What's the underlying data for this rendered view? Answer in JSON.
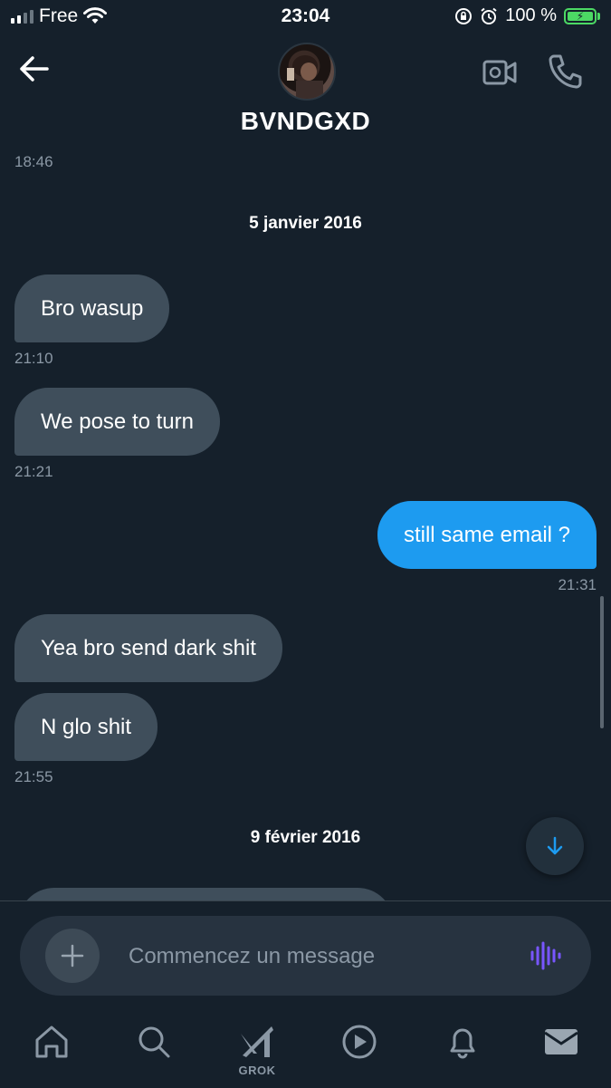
{
  "status_bar": {
    "carrier": "Free",
    "time": "23:04",
    "battery": "100 %"
  },
  "header": {
    "contact_name": "BVNDGXD",
    "avatar_icon": "avatar-photo",
    "back_icon": "arrow-left-icon",
    "video_icon": "video-camera-icon",
    "call_icon": "phone-icon"
  },
  "conversation": {
    "top_time": "18:46",
    "date_1": "5 janvier 2016",
    "msg_1": "Bro wasup",
    "time_1": "21:10",
    "msg_2": "We pose to turn",
    "time_2": "21:21",
    "msg_3": "still same email ?",
    "time_3": "21:31",
    "msg_4": "Yea bro send dark shit",
    "msg_5": "N glo shit",
    "time_5": "21:55",
    "date_2": "9 février 2016"
  },
  "composer": {
    "placeholder": "Commencez un message",
    "add_icon": "plus-icon",
    "voice_icon": "voice-waveform-icon"
  },
  "tabbar": {
    "grok_label": "GROK",
    "tabs": [
      "home-icon",
      "search-icon",
      "grok-icon",
      "play-icon",
      "bell-icon",
      "mail-icon"
    ]
  },
  "colors": {
    "background": "#15202b",
    "incoming_bubble": "#3f4e5b",
    "outgoing_bubble": "#1d9bf0",
    "accent_voice": "#7856ff",
    "battery": "#4cd964"
  }
}
